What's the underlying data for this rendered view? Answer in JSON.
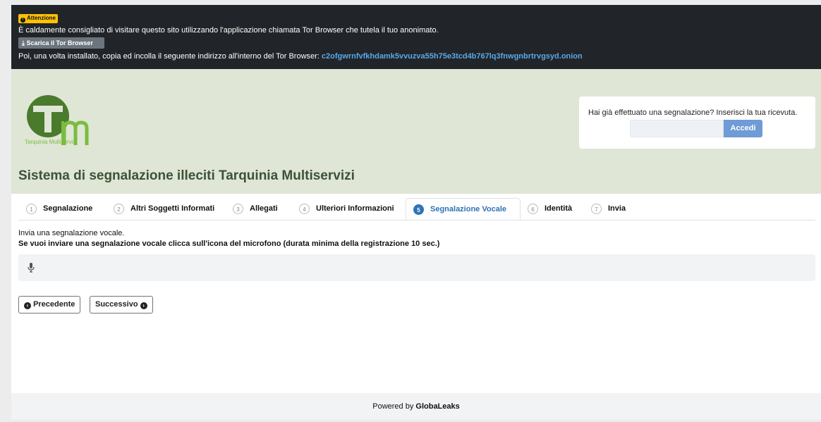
{
  "tor_banner": {
    "badge": "Attenzione",
    "message": "È caldamente consigliato di visitare questo sito utilizzando l'applicazione chiamata Tor Browser che tutela il tuo anonimato.",
    "download_button": "Scarica il Tor Browser",
    "instruction": "Poi, una volta installato, copia ed incolla il seguente indirizzo all'interno del Tor Browser:",
    "onion_address": "c2ofgwrnfvfkhdamk5vvuzva55h75e3tcd4b767lq3fnwgnbrtrvgsyd.onion"
  },
  "header": {
    "logo_caption": "Tarquinia Multiservizi",
    "title": "Sistema di segnalazione illeciti Tarquinia Multiservizi",
    "receipt": {
      "prompt": "Hai già effettuato una segnalazione? Inserisci la tua ricevuta.",
      "input_value": "",
      "button": "Accedi"
    }
  },
  "tabs": [
    {
      "num": "1",
      "label": "Segnalazione"
    },
    {
      "num": "2",
      "label": "Altri Soggetti Informati"
    },
    {
      "num": "3",
      "label": "Allegati"
    },
    {
      "num": "4",
      "label": "Ulteriori Informazioni"
    },
    {
      "num": "5",
      "label": "Segnalazione Vocale"
    },
    {
      "num": "6",
      "label": "Identità"
    },
    {
      "num": "7",
      "label": "Invia"
    }
  ],
  "active_tab": "5",
  "step": {
    "description": "Invia una segnalazione vocale.",
    "instruction": "Se vuoi inviare una segnalazione vocale clicca sull'icona del microfono (durata minima della registrazione 10 sec.)"
  },
  "nav": {
    "previous": "Precedente",
    "next": "Successivo"
  },
  "footer": {
    "prefix": "Powered by",
    "brand": "GlobaLeaks"
  },
  "colors": {
    "accent": "#2f74b5",
    "header_bg": "#dfe6d5",
    "banner_bg": "#212529",
    "logo_green": "#4a7a2c"
  }
}
